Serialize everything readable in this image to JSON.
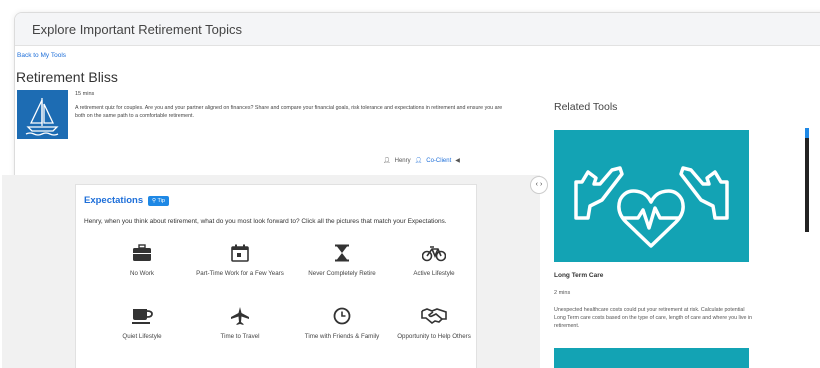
{
  "header": {
    "title": "Explore Important Retirement Topics"
  },
  "nav": {
    "back_label": "Back to My Tools"
  },
  "tool": {
    "title": "Retirement Bliss",
    "duration": "15 mins",
    "description": "A retirement quiz for couples. Are you and your partner aligned on finances? Share and compare your financial goals, risk tolerance and expectations in retirement and ensure you are both on the same path to a comfortable retirement."
  },
  "users": {
    "primary": "Henry",
    "secondary": "Co-Client"
  },
  "expectations": {
    "title": "Expectations",
    "tip_label": "Tip",
    "question": "Henry, when you think about retirement, what do you most look forward to? Click all the pictures that match your Expectations.",
    "options": [
      {
        "label": "No Work",
        "icon": "briefcase-icon"
      },
      {
        "label": "Part-Time Work for a Few Years",
        "icon": "calendar-icon"
      },
      {
        "label": "Never Completely Retire",
        "icon": "hourglass-icon"
      },
      {
        "label": "Active Lifestyle",
        "icon": "bicycle-icon"
      },
      {
        "label": "Quiet Lifestyle",
        "icon": "coffee-cup-icon"
      },
      {
        "label": "Time to Travel",
        "icon": "airplane-icon"
      },
      {
        "label": "Time with Friends & Family",
        "icon": "clock-icon"
      },
      {
        "label": "Opportunity to Help Others",
        "icon": "handshake-icon"
      }
    ]
  },
  "related": {
    "title": "Related Tools",
    "items": [
      {
        "name": "Long Term Care",
        "duration": "2 mins",
        "description": "Unexpected healthcare costs could put your retirement at risk. Calculate potential Long Term care costs based on the type of care, length of care and where you live in retirement."
      }
    ]
  },
  "colors": {
    "accent": "#1e6fd9",
    "hero_bg": "#1d6cb3",
    "tool_bg": "#13a3b4"
  }
}
